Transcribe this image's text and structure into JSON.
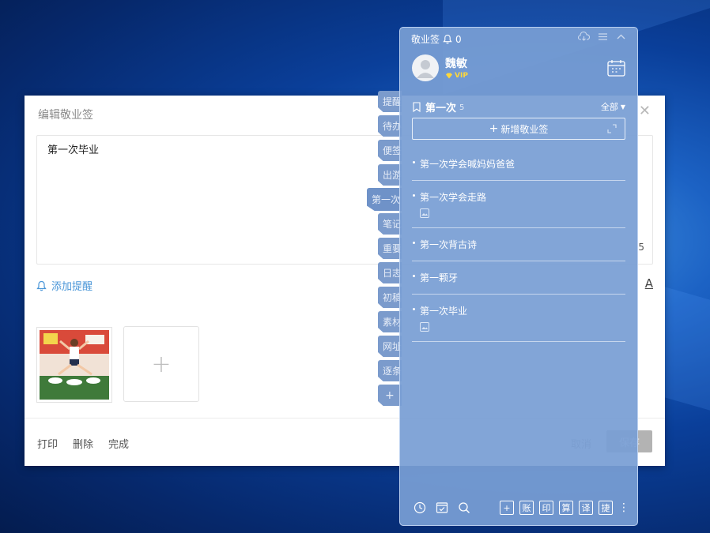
{
  "editor": {
    "title": "编辑敬业签",
    "content": "第一次毕业",
    "char_count": "5",
    "add_reminder": "添加提醒",
    "font_button": "A",
    "footer": {
      "print": "打印",
      "delete": "删除",
      "done": "完成",
      "cancel": "取消",
      "save": "保存"
    }
  },
  "tabs": [
    {
      "label": "提醒",
      "active": false
    },
    {
      "label": "待办",
      "active": false
    },
    {
      "label": "便签",
      "active": false
    },
    {
      "label": "出游",
      "active": false
    },
    {
      "label": "第一次",
      "active": true
    },
    {
      "label": "笔记",
      "active": false
    },
    {
      "label": "重要",
      "active": false
    },
    {
      "label": "日志",
      "active": false
    },
    {
      "label": "初稿",
      "active": false
    },
    {
      "label": "素材",
      "active": false
    },
    {
      "label": "网址",
      "active": false
    },
    {
      "label": "逐条",
      "active": false
    },
    {
      "label": "+",
      "active": false
    }
  ],
  "panel": {
    "app_name": "敬业签",
    "notification_count": "0",
    "user": {
      "name": "魏敏",
      "badge": "VIP"
    },
    "folder": {
      "title": "第一次",
      "count": "5",
      "filter": "全部"
    },
    "new_note_label": "新增敬业签",
    "notes": [
      {
        "text": "第一次学会喊妈妈爸爸",
        "has_image": false
      },
      {
        "text": "第一次学会走路",
        "has_image": true
      },
      {
        "text": "第一次背古诗",
        "has_image": false
      },
      {
        "text": "第一颗牙",
        "has_image": false
      },
      {
        "text": "第一次毕业",
        "has_image": true
      }
    ],
    "toolbar_buttons": [
      "+",
      "账",
      "印",
      "算",
      "译",
      "捷"
    ]
  },
  "colors": {
    "panel_bg": "#789ed4",
    "tab_bg": "#7b9bcc",
    "link_blue": "#4a96d8",
    "vip_gold": "#ffd83a"
  }
}
